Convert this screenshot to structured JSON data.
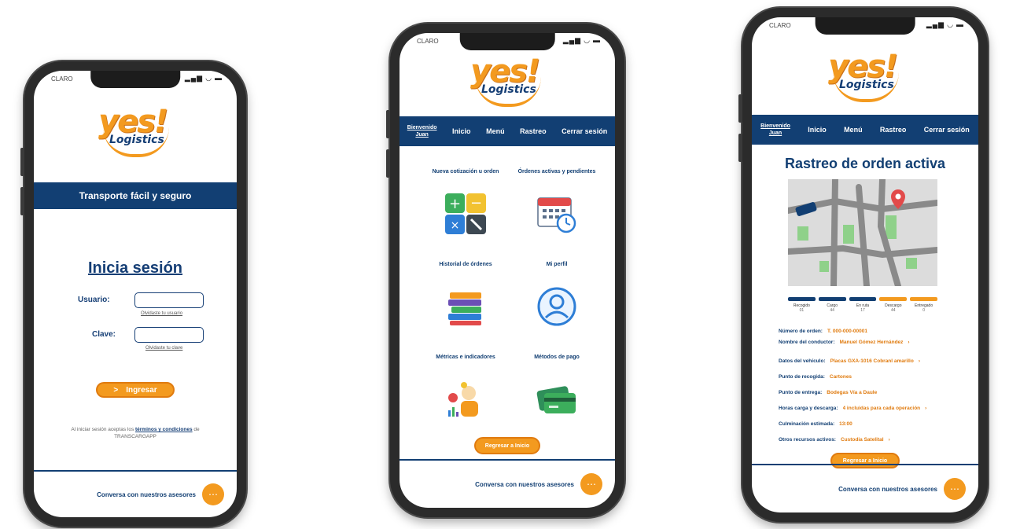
{
  "status": {
    "carrier": "CLARO",
    "icons": "▂▄▆ ◡ ▬"
  },
  "logo": {
    "brand": "yes!",
    "sub": "Logistics"
  },
  "login": {
    "banner": "Transporte fácil y seguro",
    "title": "Inicia sesión",
    "user_label": "Usuario:",
    "user_value": "",
    "forgot_user": "Olvidaste tu usuario",
    "password_label": "Clave:",
    "password_value": "",
    "forgot_password": "Olvidaste tu clave",
    "submit_arrow": ">",
    "submit": "Ingresar",
    "terms_prefix": "Al iniciar sesión aceptas los ",
    "terms_link": "términos y condiciones",
    "terms_suffix": " de TRANSCARGAPP"
  },
  "chat": {
    "label": "Conversa con nuestros asesores",
    "icon": "chat-bubble-icon"
  },
  "nav": {
    "welcome_line1": "Bienvenido",
    "welcome_line2": "Juan",
    "items": [
      "Inicio",
      "Menú",
      "Rastreo",
      "Cerrar sesión"
    ]
  },
  "menu": {
    "items": [
      {
        "label": "Nueva cotización u orden",
        "icon": "calculator-icon"
      },
      {
        "label": "Órdenes activas y pendientes",
        "icon": "calendar-clock-icon"
      },
      {
        "label": "Historial de órdenes",
        "icon": "books-icon"
      },
      {
        "label": "Mi perfil",
        "icon": "user-profile-icon"
      },
      {
        "label": "Métricas e indicadores",
        "icon": "metrics-icon"
      },
      {
        "label": "Métodos de pago",
        "icon": "credit-cards-icon"
      }
    ],
    "back_button": "Regresar a Inicio"
  },
  "tracking": {
    "title": "Rastreo de orden activa",
    "steps": [
      {
        "label": "Recogido",
        "value": "01",
        "color": "#123f73"
      },
      {
        "label": "Cargo",
        "value": "44",
        "color": "#123f73"
      },
      {
        "label": "En ruta",
        "value": "17",
        "color": "#123f73"
      },
      {
        "label": "Descargo",
        "value": "44",
        "color": "#f39a1f"
      },
      {
        "label": "Entregado",
        "value": "0",
        "color": "#f39a1f"
      }
    ],
    "details": [
      {
        "key": "Número de orden:",
        "value": "T. 000-000-00001",
        "chevron": ""
      },
      {
        "key": "Nombre del conductor:",
        "value": "Manuel Gómez Hernández",
        "chevron": "›"
      },
      {
        "key": "Datos del vehículo:",
        "value": "Placas GXA-1016 Cobranl amarillo",
        "chevron": "›"
      },
      {
        "key": "Punto de recogida:",
        "value": "Cartones",
        "chevron": ""
      },
      {
        "key": "Punto de entrega:",
        "value": "Bodegas Vía a Daule",
        "chevron": ""
      },
      {
        "key": "Horas carga y descarga:",
        "value": "4 incluidas para cada operación",
        "chevron": "›"
      },
      {
        "key": "Culminación estimada:",
        "value": "13:00",
        "chevron": ""
      },
      {
        "key": "Otros recursos activos:",
        "value": "Custodia Satelital",
        "chevron": "›"
      }
    ],
    "back_button": "Regresar a Inicio"
  },
  "colors": {
    "brand_blue": "#123f73",
    "brand_orange": "#f39a1f"
  }
}
